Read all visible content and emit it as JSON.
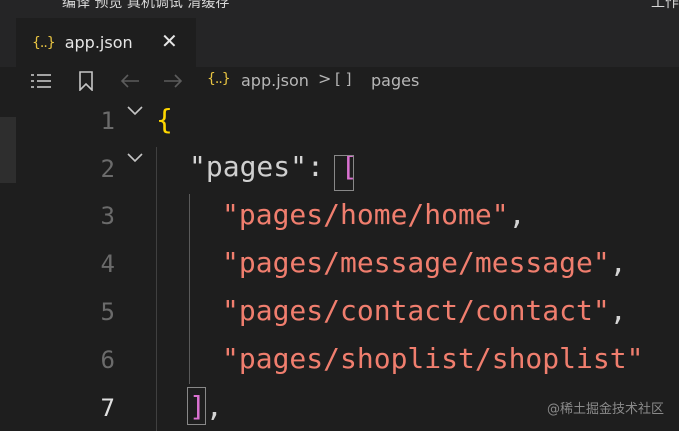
{
  "top": {
    "menu_text": "编译  预览  真机调试  清缓存",
    "right_text": "工作"
  },
  "tab": {
    "icon_text": "{..}",
    "name": "app.json",
    "close_glyph": "✕"
  },
  "breadcrumb": {
    "file_icon_text": "{..}",
    "file": "app.json",
    "separator": ">",
    "array_icon_text": "[ ]",
    "node": "pages"
  },
  "editor": {
    "line_numbers": [
      "1",
      "2",
      "3",
      "4",
      "5",
      "6",
      "7"
    ],
    "lines": [
      {
        "brace": "{"
      },
      {
        "q1": "\"",
        "key": "pages",
        "q2": "\"",
        "colon": ": ",
        "bracket": "["
      },
      {
        "str": "\"pages/home/home\"",
        "comma": ","
      },
      {
        "str": "\"pages/message/message\"",
        "comma": ","
      },
      {
        "str": "\"pages/contact/contact\"",
        "comma": ","
      },
      {
        "str": "\"pages/shoplist/shoplist\""
      },
      {
        "bracket": "]",
        "comma": ","
      }
    ]
  },
  "watermark": "@稀土掘金技术社区",
  "colors": {
    "string": "#f07e6e",
    "bracket": "#d971d0",
    "brace": "#ffd700",
    "json_icon": "#e8c442"
  }
}
